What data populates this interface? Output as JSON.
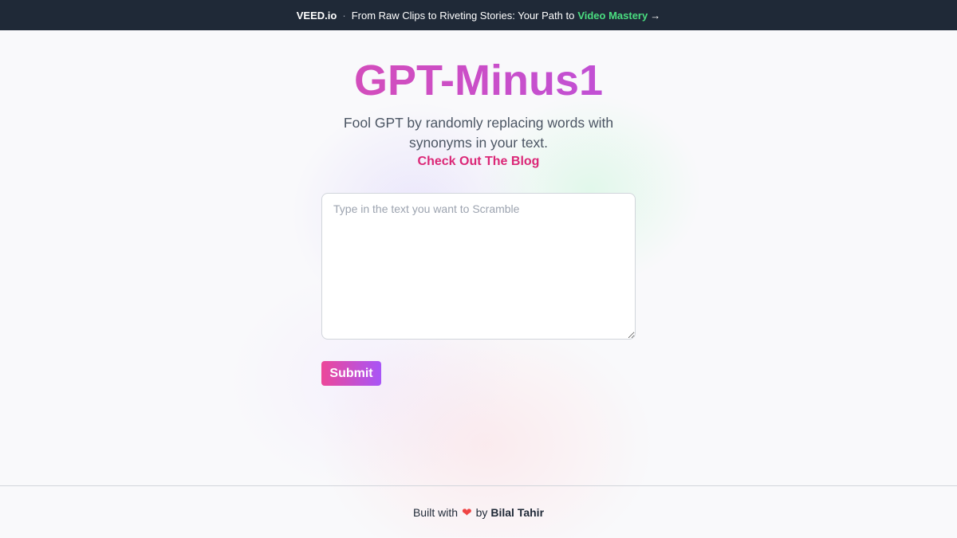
{
  "banner": {
    "brand": "VEED.io",
    "separator": "·",
    "message": "From Raw Clips to Riveting Stories: Your Path to",
    "highlight": "Video Mastery",
    "arrow": "→"
  },
  "hero": {
    "title": "GPT-Minus1",
    "subtitle": "Fool GPT by randomly replacing words with synonyms in your text.",
    "blog_link": "Check Out The Blog"
  },
  "form": {
    "textarea_placeholder": "Type in the text you want to Scramble",
    "textarea_value": "",
    "submit_label": "Submit"
  },
  "footer": {
    "prefix": "Built with",
    "heart": "❤",
    "by": "by",
    "author": "Bilal Tahir"
  },
  "colors": {
    "banner_bg": "#1f2937",
    "highlight": "#4ade80",
    "gradient_start": "#ec4899",
    "gradient_end": "#a855f7",
    "link": "#db2777",
    "heart": "#ef4444"
  },
  "icons": {
    "arrow": "arrow-right-icon",
    "heart": "heart-icon"
  }
}
